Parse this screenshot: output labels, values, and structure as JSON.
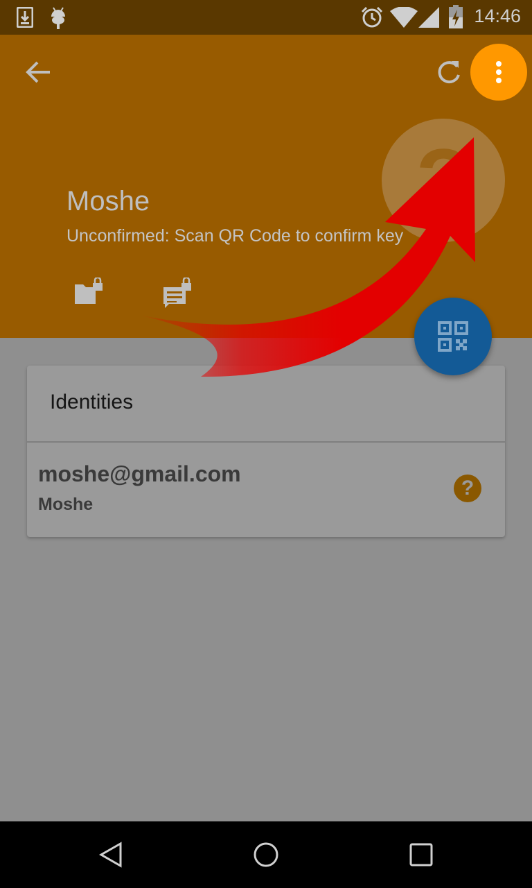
{
  "status_bar": {
    "time": "14:46",
    "icons": [
      "download-icon",
      "android-icon",
      "alarm-icon",
      "wifi-icon",
      "signal-icon",
      "battery-icon"
    ]
  },
  "toolbar": {
    "back_icon": "back-arrow-icon",
    "refresh_icon": "refresh-icon",
    "overflow_icon": "more-vert-icon"
  },
  "contact": {
    "name": "Moshe",
    "status": "Unconfirmed: Scan QR Code to confirm key",
    "avatar_glyph": "?",
    "actions": [
      "encrypted-file-icon",
      "encrypted-message-icon"
    ]
  },
  "fab": {
    "icon": "qr-code-icon"
  },
  "identities": {
    "title": "Identities",
    "items": [
      {
        "email": "moshe@gmail.com",
        "name": "Moshe",
        "badge": "?"
      }
    ]
  },
  "nav": {
    "icons": [
      "back-triangle-icon",
      "home-circle-icon",
      "recents-square-icon"
    ]
  },
  "colors": {
    "header": "#985b00",
    "status_bar": "#5a3800",
    "scrim": "#8f8f8f",
    "overflow_fab": "#ff9800",
    "qr_fab": "#135a96",
    "arrow": "#e30000"
  }
}
